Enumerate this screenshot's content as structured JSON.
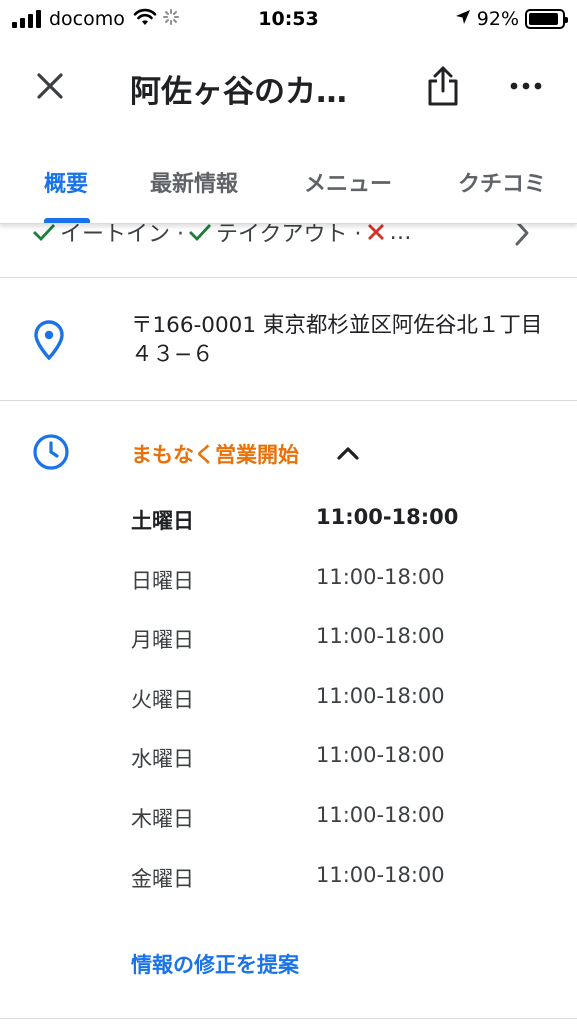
{
  "status_bar": {
    "carrier": "docomo",
    "time": "10:53",
    "battery_percent": "92%",
    "battery_level": 0.92
  },
  "header": {
    "title": "阿佐ヶ谷のカ…",
    "close_icon": "close-icon",
    "share_icon": "share-icon",
    "more_icon": "more-horizontal-icon"
  },
  "tabs": [
    {
      "label": "概要",
      "active": true
    },
    {
      "label": "最新情報",
      "active": false
    },
    {
      "label": "メニュー",
      "active": false
    },
    {
      "label": "クチコミ",
      "active": false
    }
  ],
  "services": {
    "items": [
      {
        "label": "イートイン ·",
        "status": "check"
      },
      {
        "label": "テイクアウト ·",
        "status": "check"
      },
      {
        "label": "…",
        "status": "cross"
      }
    ]
  },
  "address": {
    "text": "〒166-0001 東京都杉並区阿佐谷北１丁目４３−６"
  },
  "hours": {
    "status": "まもなく営業開始",
    "rows": [
      {
        "day": "土曜日",
        "time": "11:00-18:00"
      },
      {
        "day": "日曜日",
        "time": "11:00-18:00"
      },
      {
        "day": "月曜日",
        "time": "11:00-18:00"
      },
      {
        "day": "火曜日",
        "time": "11:00-18:00"
      },
      {
        "day": "水曜日",
        "time": "11:00-18:00"
      },
      {
        "day": "木曜日",
        "time": "11:00-18:00"
      },
      {
        "day": "金曜日",
        "time": "11:00-18:00"
      }
    ],
    "suggest_edit": "情報の修正を提案"
  },
  "colors": {
    "accent": "#1a73e8",
    "status_orange": "#e8710a",
    "check_green": "#188038",
    "cross_red": "#d93025"
  }
}
